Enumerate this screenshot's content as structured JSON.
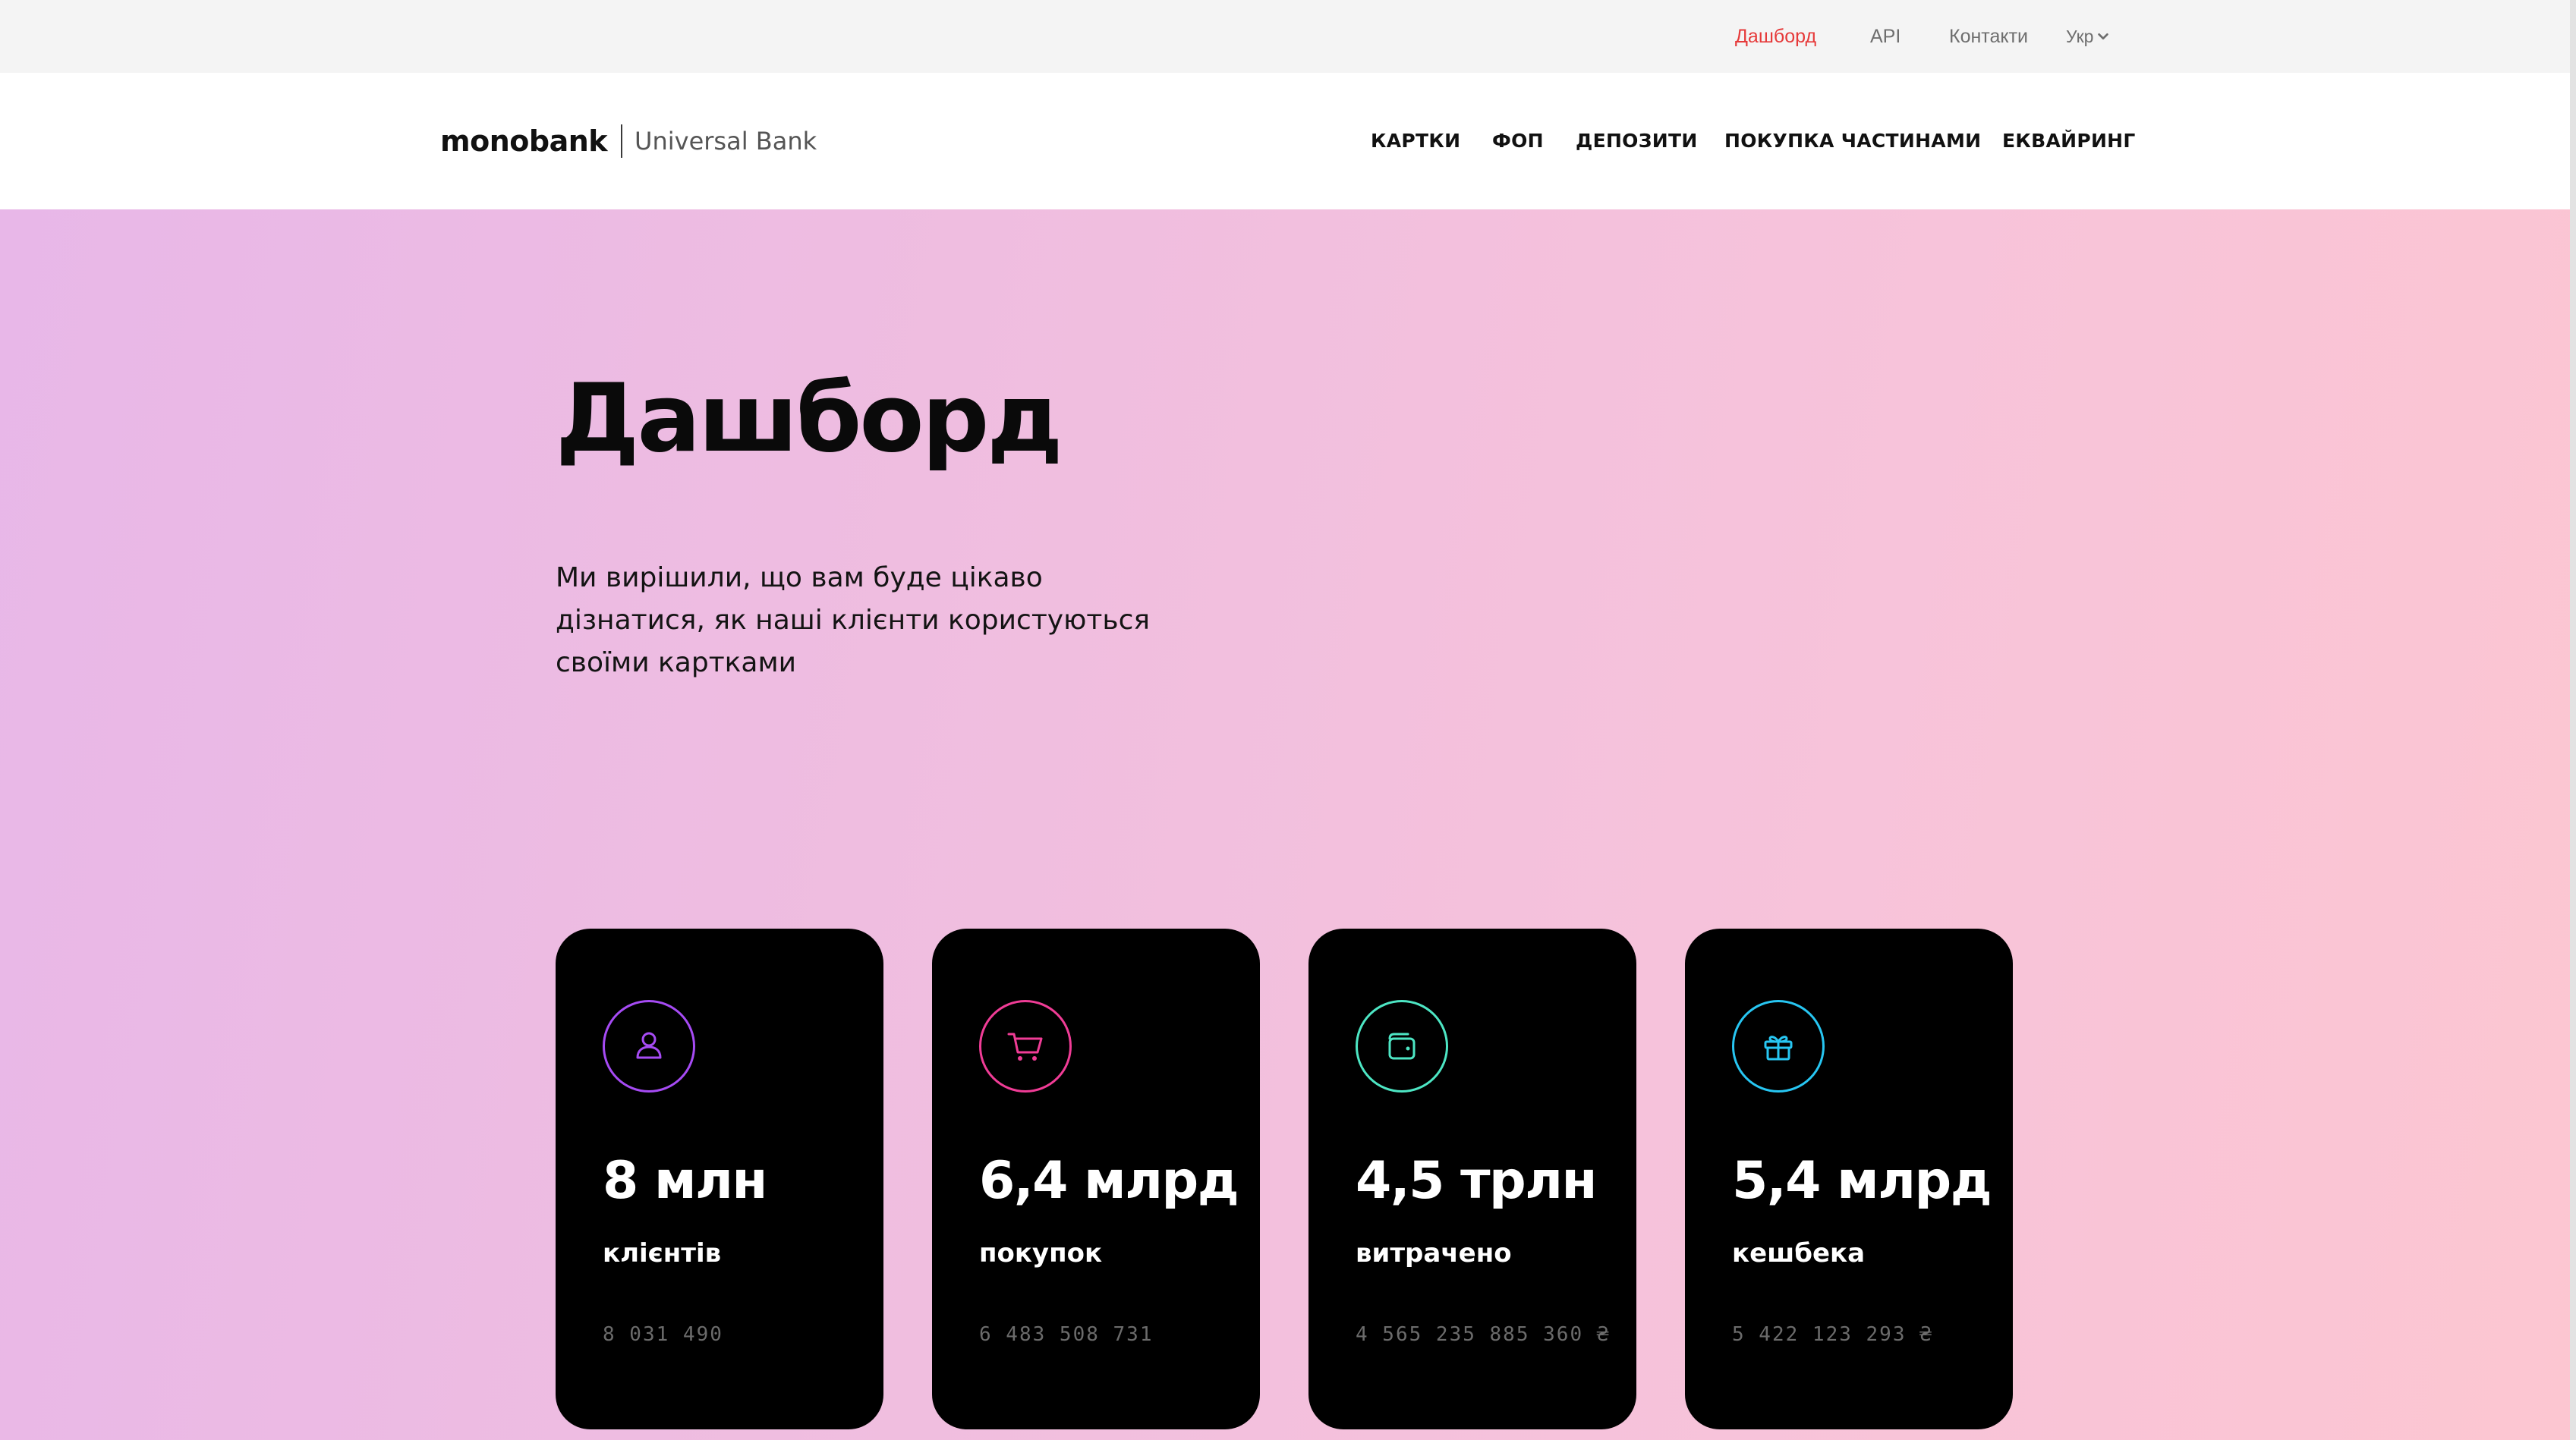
{
  "topbar": {
    "links": [
      {
        "label": "Дашборд",
        "active": true
      },
      {
        "label": "API",
        "active": false
      },
      {
        "label": "Контакти",
        "active": false
      }
    ],
    "language": "Укр"
  },
  "header": {
    "brand": "monobank",
    "brand_sub": "Universal Bank",
    "nav": [
      "КАРТКИ",
      "ФОП",
      "ДЕПОЗИТИ",
      "ПОКУПКА ЧАСТИНАМИ",
      "ЕКВАЙРИНГ"
    ]
  },
  "hero": {
    "title": "Дашборд",
    "lead": "Ми вирішили, що вам буде цікаво дізнатися, як наші клієнти користуються своїми картками"
  },
  "cards": [
    {
      "icon": "user-icon",
      "accent": "#a64bf4",
      "value": "8 млн",
      "label": "клієнтів",
      "exact": "8 031 490"
    },
    {
      "icon": "shopping-cart-icon",
      "accent": "#f03c96",
      "value": "6,4 млрд",
      "label": "покупок",
      "exact": "6 483 508 731"
    },
    {
      "icon": "wallet-icon",
      "accent": "#4de6c4",
      "value": "4,5 трлн",
      "label": "витрачено",
      "exact": "4 565 235 885 360 ₴"
    },
    {
      "icon": "gift-icon",
      "accent": "#27c6f2",
      "value": "5,4 млрд",
      "label": "кешбека",
      "exact": "5 422 123 293 ₴"
    }
  ],
  "colors": {
    "active_link": "#e63a3a",
    "card_background": "#000000"
  }
}
